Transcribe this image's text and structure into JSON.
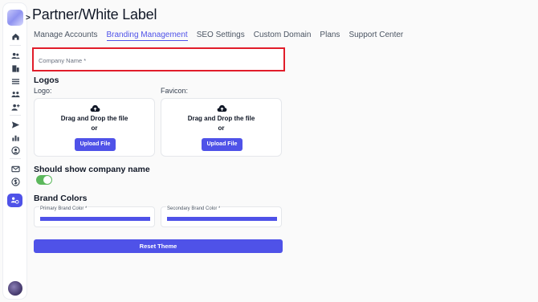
{
  "page": {
    "title": "Partner/White Label"
  },
  "sidebar": {
    "expand_glyph": ">",
    "icons": [
      "home-icon",
      "users-icon",
      "building-icon",
      "list-icon",
      "team-icon",
      "add-user-icon",
      "send-icon",
      "chart-icon",
      "user-circle-icon",
      "mail-icon",
      "dollar-icon",
      "partner-icon"
    ],
    "active_icon": "partner-icon",
    "accent_color": "#4f52e8"
  },
  "tabs": [
    {
      "label": "Manage Accounts",
      "active": false
    },
    {
      "label": "Branding Management",
      "active": true
    },
    {
      "label": "SEO Settings",
      "active": false
    },
    {
      "label": "Custom Domain",
      "active": false
    },
    {
      "label": "Plans",
      "active": false
    },
    {
      "label": "Support Center",
      "active": false
    }
  ],
  "form": {
    "company_name_placeholder": "Company Name *",
    "company_name_value": "",
    "logos_heading": "Logos",
    "logo_label": "Logo:",
    "favicon_label": "Favicon:",
    "logo_upload": {
      "line1": "Drag and Drop the file",
      "line2": "or",
      "button": "Upload File"
    },
    "favicon_upload": {
      "line1": "Drag and Drop the file",
      "line2": "or",
      "button": "Upload File"
    },
    "show_company_heading": "Should show company name",
    "show_company_enabled": true,
    "brand_colors_heading": "Brand Colors",
    "primary_color_label": "Primary Brand Color *",
    "primary_color_value": "#4f52e8",
    "secondary_color_label": "Secondary Brand Color *",
    "secondary_color_value": "#4f52e8",
    "reset_button": "Reset Theme"
  }
}
